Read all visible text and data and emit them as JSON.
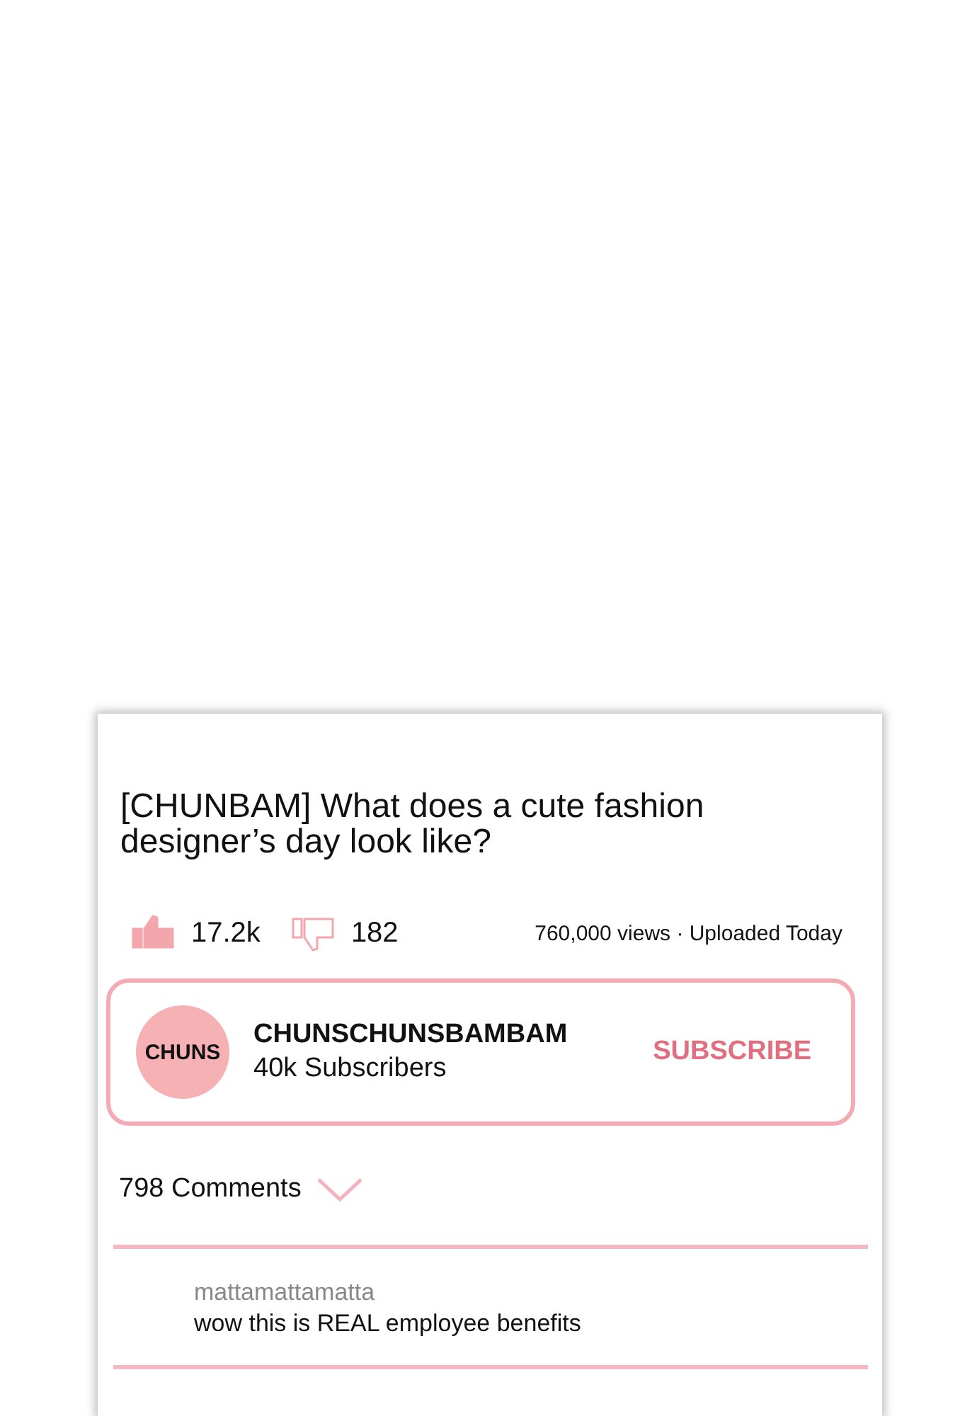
{
  "video": {
    "title": "[CHUNBAM] What does a cute fashion designer’s day look like?",
    "likes": {
      "count": "17.2k",
      "selected": true
    },
    "dislikes": {
      "count": "182",
      "selected": false
    },
    "meta": "760,000 views · Uploaded Today"
  },
  "channel": {
    "avatar_text": "CHUNS",
    "name": "CHUNSCHUNSBAMBAM",
    "subscribers": "40k Subscribers",
    "subscribe_label": "SUBSCRIBE"
  },
  "comments": {
    "count_label": "798 Comments",
    "items": [
      {
        "author": "mattamattamatta",
        "text": "wow this is REAL employee benefits"
      }
    ]
  }
}
